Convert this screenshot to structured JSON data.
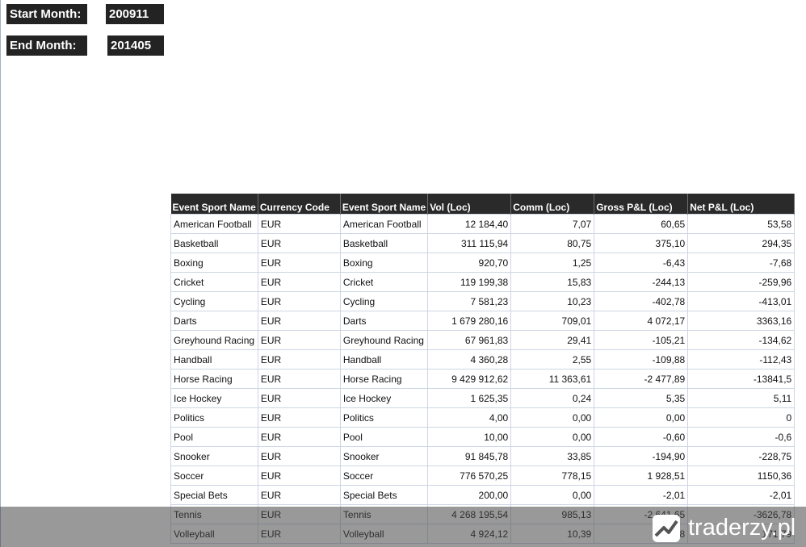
{
  "params": {
    "start_label": "Start Month:",
    "start_value": "200911",
    "end_label": "End Month:",
    "end_value": "201405"
  },
  "table": {
    "columns": [
      "Event Sport Name",
      "Currency Code",
      "Event Sport Name",
      "Vol (Loc)",
      "Comm (Loc)",
      "Gross P&L (Loc)",
      "Net P&L (Loc)"
    ],
    "rows": [
      [
        "American Football",
        "EUR",
        "American Football",
        "12 184,40",
        "7,07",
        "60,65",
        "53,58"
      ],
      [
        "Basketball",
        "EUR",
        "Basketball",
        "311 115,94",
        "80,75",
        "375,10",
        "294,35"
      ],
      [
        "Boxing",
        "EUR",
        "Boxing",
        "920,70",
        "1,25",
        "-6,43",
        "-7,68"
      ],
      [
        "Cricket",
        "EUR",
        "Cricket",
        "119 199,38",
        "15,83",
        "-244,13",
        "-259,96"
      ],
      [
        "Cycling",
        "EUR",
        "Cycling",
        "7 581,23",
        "10,23",
        "-402,78",
        "-413,01"
      ],
      [
        "Darts",
        "EUR",
        "Darts",
        "1 679 280,16",
        "709,01",
        "4 072,17",
        "3363,16"
      ],
      [
        "Greyhound Racing",
        "EUR",
        "Greyhound Racing",
        "67 961,83",
        "29,41",
        "-105,21",
        "-134,62"
      ],
      [
        "Handball",
        "EUR",
        "Handball",
        "4 360,28",
        "2,55",
        "-109,88",
        "-112,43"
      ],
      [
        "Horse Racing",
        "EUR",
        "Horse Racing",
        "9 429 912,62",
        "11 363,61",
        "-2 477,89",
        "-13841,5"
      ],
      [
        "Ice Hockey",
        "EUR",
        "Ice Hockey",
        "1 625,35",
        "0,24",
        "5,35",
        "5,11"
      ],
      [
        "Politics",
        "EUR",
        "Politics",
        "4,00",
        "0,00",
        "0,00",
        "0"
      ],
      [
        "Pool",
        "EUR",
        "Pool",
        "10,00",
        "0,00",
        "-0,60",
        "-0,6"
      ],
      [
        "Snooker",
        "EUR",
        "Snooker",
        "91 845,78",
        "33,85",
        "-194,90",
        "-228,75"
      ],
      [
        "Soccer",
        "EUR",
        "Soccer",
        "776 570,25",
        "778,15",
        "1 928,51",
        "1150,36"
      ],
      [
        "Special Bets",
        "EUR",
        "Special Bets",
        "200,00",
        "0,00",
        "-2,01",
        "-2,01"
      ],
      [
        "Tennis",
        "EUR",
        "Tennis",
        "4 268 195,54",
        "985,13",
        "-2 641,65",
        "-3626,78"
      ],
      [
        "Volleyball",
        "EUR",
        "Volleyball",
        "4 924,12",
        "10,39",
        "182,18",
        "171,79"
      ]
    ]
  },
  "watermark": {
    "text": "traderzy.pl",
    "icon": "traderzy-logo-icon"
  },
  "colors": {
    "header_bg": "#2a2a2a",
    "header_text": "#ffffff",
    "grid_line": "#cdd6e4"
  }
}
